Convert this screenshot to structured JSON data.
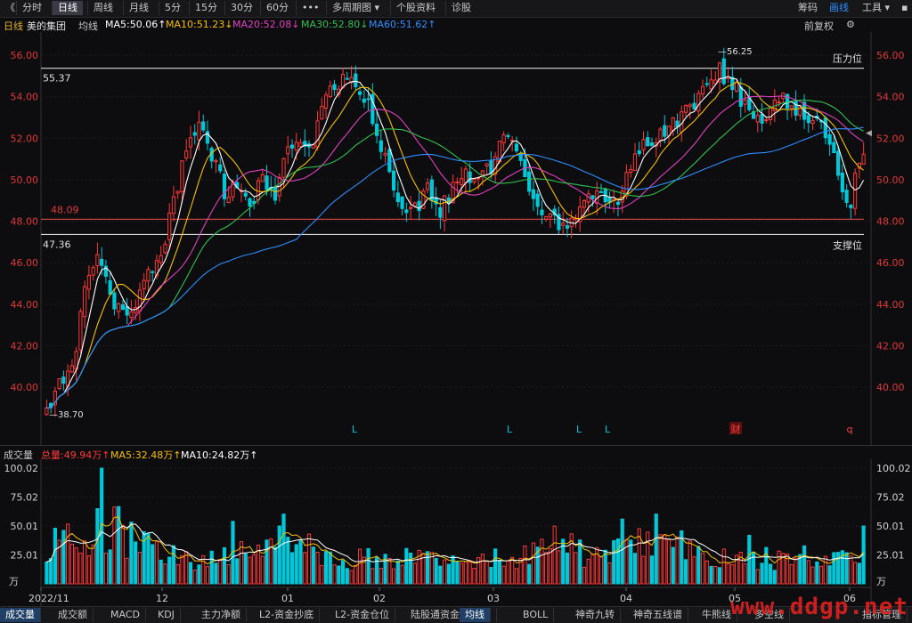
{
  "toolbar": {
    "back_glyph": "《",
    "items": [
      "分时",
      "日线",
      "周线",
      "月线",
      "5分",
      "15分",
      "30分",
      "60分",
      "•••",
      "多周期图 ▾",
      "个股资料",
      "诊股"
    ],
    "active_index": 1,
    "right_items": [
      "筹码",
      "画线",
      "工具 ▾",
      "▪"
    ],
    "right_active_index": 1
  },
  "title_bar": {
    "period": "日线",
    "stock_name": "美的集团",
    "ma_label": "均线",
    "ma5": "MA5:50.06↑",
    "ma10": "MA10:51.23↓",
    "ma20": "MA20:52.08↓",
    "ma30": "MA30:52.80↓",
    "ma60": "MA60:51.62↑",
    "adjust": "前复权",
    "colors": {
      "ma5": "#ffffff",
      "ma10": "#f5c000",
      "ma20": "#e040c0",
      "ma30": "#30c050",
      "ma60": "#2e8dff",
      "up": "#ff3838",
      "down": "#00c8d8"
    }
  },
  "chart_data": [
    {
      "type": "candlestick",
      "title": "",
      "ylim": [
        39.0,
        57.0
      ],
      "yticks": [
        "56.00",
        "54.00",
        "52.00",
        "50.00",
        "48.00",
        "46.00",
        "44.00",
        "42.00",
        "40.00"
      ],
      "ytick_values": [
        56,
        54,
        52,
        50,
        48,
        46,
        44,
        42,
        40
      ],
      "x_ticks": [
        "2022/11",
        "12",
        "01",
        "02",
        "03",
        "04",
        "05",
        "06"
      ],
      "grid": true,
      "horizontal_lines": [
        {
          "value": 55.37,
          "label_left": "55.37",
          "label_right": "压力位",
          "color": "#d8d8d8"
        },
        {
          "value": 48.09,
          "label_left": "48.09",
          "label_right": "",
          "color": "#c84040"
        },
        {
          "value": 47.36,
          "label_left": "47.36",
          "label_right": "支撑位",
          "color": "#d8d8d8"
        }
      ],
      "annotations": {
        "high": "56.25",
        "low": "38.70",
        "event_marks": [
          "L",
          "L",
          "L",
          "L",
          "财",
          "q"
        ]
      },
      "knots": [
        [
          0,
          39.0
        ],
        [
          3,
          40.0
        ],
        [
          6,
          40.8
        ],
        [
          9,
          44.6
        ],
        [
          12,
          46.6
        ],
        [
          15,
          44.6
        ],
        [
          18,
          43.4
        ],
        [
          21,
          44.2
        ],
        [
          24,
          45.4
        ],
        [
          27,
          46.4
        ],
        [
          30,
          49.0
        ],
        [
          33,
          51.6
        ],
        [
          36,
          52.4
        ],
        [
          39,
          51.2
        ],
        [
          42,
          49.4
        ],
        [
          45,
          49.6
        ],
        [
          48,
          49.0
        ],
        [
          51,
          49.8
        ],
        [
          54,
          49.2
        ],
        [
          57,
          51.6
        ],
        [
          60,
          52.2
        ],
        [
          63,
          51.8
        ],
        [
          66,
          54.2
        ],
        [
          69,
          54.8
        ],
        [
          72,
          54.8
        ],
        [
          75,
          54.0
        ],
        [
          78,
          52.4
        ],
        [
          81,
          50.6
        ],
        [
          84,
          48.6
        ],
        [
          87,
          48.6
        ],
        [
          90,
          49.6
        ],
        [
          93,
          48.6
        ],
        [
          96,
          49.6
        ],
        [
          99,
          50.2
        ],
        [
          102,
          50.0
        ],
        [
          105,
          50.6
        ],
        [
          108,
          52.2
        ],
        [
          111,
          51.2
        ],
        [
          114,
          49.6
        ],
        [
          117,
          48.6
        ],
        [
          120,
          48.0
        ],
        [
          123,
          47.6
        ],
        [
          126,
          48.6
        ],
        [
          129,
          49.4
        ],
        [
          132,
          49.0
        ],
        [
          135,
          49.2
        ],
        [
          138,
          50.6
        ],
        [
          141,
          51.6
        ],
        [
          144,
          52.0
        ],
        [
          147,
          52.6
        ],
        [
          150,
          53.0
        ],
        [
          153,
          53.6
        ],
        [
          156,
          54.6
        ],
        [
          159,
          55.2
        ],
        [
          162,
          54.6
        ],
        [
          165,
          53.6
        ],
        [
          168,
          53.0
        ],
        [
          171,
          53.4
        ],
        [
          174,
          54.0
        ],
        [
          177,
          53.2
        ],
        [
          180,
          53.0
        ],
        [
          183,
          52.6
        ],
        [
          186,
          51.0
        ],
        [
          188,
          49.6
        ],
        [
          190,
          49.0
        ],
        [
          193,
          51.6
        ]
      ]
    },
    {
      "type": "bar",
      "title": "成交量",
      "ylim": [
        0,
        100.02
      ],
      "yticks": [
        "100.02",
        "75.02",
        "50.01",
        "25.01",
        "万"
      ],
      "ytick_values": [
        100.02,
        75.02,
        50.01,
        25.01
      ],
      "base": [
        34,
        36,
        30,
        27,
        30,
        35,
        48,
        38,
        36,
        32,
        30,
        24,
        22,
        20,
        22,
        24,
        28,
        30,
        32,
        34,
        40,
        44,
        40,
        32,
        26,
        22,
        20,
        20,
        22,
        22,
        24,
        22,
        22,
        24,
        26,
        26,
        24,
        24,
        22,
        24,
        22,
        22,
        24,
        26,
        28,
        28,
        36,
        32,
        28,
        26,
        24,
        26,
        30,
        34,
        40,
        42,
        38,
        32,
        28,
        26,
        22,
        22,
        24,
        26,
        22,
        22,
        20,
        20,
        22,
        24,
        22,
        20,
        20,
        26,
        32
      ],
      "spikes": {
        "12": 65,
        "13": 100,
        "44": 54,
        "55": 50,
        "136": 56,
        "166": 42,
        "193": 50
      }
    }
  ],
  "volume_bar": {
    "label": "成交量",
    "total": "总量:49.94万↑",
    "ma5": "MA5:32.48万↑",
    "ma10": "MA10:24.82万↑"
  },
  "bottom_bar": {
    "items": [
      "成交量",
      "成交额",
      "MACD",
      "KDJ",
      "主力净额",
      "L2-资金抄底",
      "L2-资金仓位",
      "陆股通资金",
      "❯",
      "均线",
      "BOLL",
      "神奇九转",
      "神奇五线谱",
      "牛熊线",
      "多空线",
      "指标管理"
    ],
    "active_indices": [
      0,
      9
    ]
  },
  "watermark": "www.ddgp.net"
}
